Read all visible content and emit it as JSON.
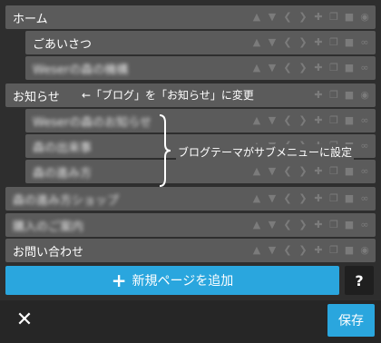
{
  "menu": {
    "items": [
      {
        "label": "ホーム",
        "blurred": false
      },
      {
        "label": "ごあいさつ",
        "blurred": false
      },
      {
        "label": "Weserの森の機構",
        "blurred": true
      },
      {
        "label": "お知らせ",
        "blurred": false
      },
      {
        "label": "Weserの森のお知らせ",
        "blurred": true
      },
      {
        "label": "森の出来事",
        "blurred": true
      },
      {
        "label": "森の進み方",
        "blurred": true
      },
      {
        "label": "森の進み方ショップ",
        "blurred": true
      },
      {
        "label": "購入のご案内",
        "blurred": true
      },
      {
        "label": "お問い合わせ",
        "blurred": false
      }
    ]
  },
  "annotations": {
    "rename_note": "←「ブログ」を「お知らせ」に変更",
    "submenu_note": "ブログテーマがサブメニューに設定"
  },
  "buttons": {
    "add_page_label": "新規ページを追加",
    "add_page_plus": "+",
    "help_label": "?",
    "close_label": "✕",
    "save_label": "保存"
  },
  "icon_names": [
    "chevron-up-icon",
    "chevron-down-icon",
    "chevron-left-icon",
    "chevron-right-icon",
    "plus-icon",
    "copy-icon",
    "trash-icon",
    "eye-icon",
    "link-icon"
  ],
  "colors": {
    "row": "#5b5b5b",
    "accent": "#2aa6de",
    "background": "#2e2e2e",
    "icon": "#7b7b7b"
  }
}
